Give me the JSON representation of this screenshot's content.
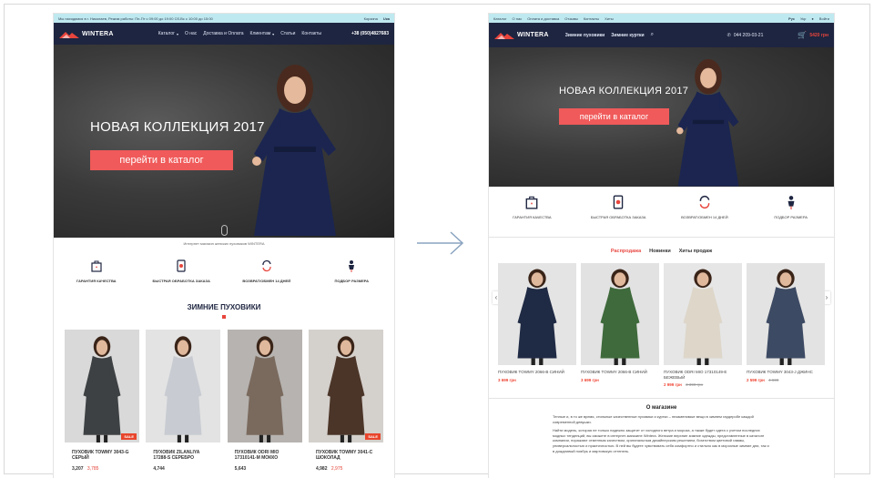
{
  "left": {
    "topbar": {
      "info": "Мы находимся в г. Николаев, Режим работы: Пн-Пт с 09:00 до 19:00 Сб-Вс с 10:00 до 15:00",
      "right1": "Корзина",
      "right2": "Uка"
    },
    "nav": {
      "brand": "WINTERA",
      "items": [
        "Каталог",
        "О нас",
        "Доставка и Оплата",
        "Клиентам",
        "Статьи",
        "Контакты"
      ],
      "phone": "+38 (050)4827683"
    },
    "hero": {
      "title": "НОВАЯ КОЛЛЕКЦИЯ 2017",
      "cta": "перейти в каталог"
    },
    "caption": "Интернет магазин женских пуховиков WINTERA",
    "features": [
      {
        "icon": "shopping-bag-icon",
        "label": "ГАРАНТИЯ КАЧЕСТВА"
      },
      {
        "icon": "phone-order-icon",
        "label": "БЫСТРАЯ ОБРАБОТКА ЗАКАЗА"
      },
      {
        "icon": "exchange-arrows-icon",
        "label": "ВОЗВРАТ/ОБМЕН 14 ДНЕЙ"
      },
      {
        "icon": "mannequin-icon",
        "label": "ПОДБОР РАЗМЕРА"
      }
    ],
    "section_title": "ЗИМНИЕ ПУХОВИКИ",
    "products": [
      {
        "name": "ПУХОВИК TOWMY 3043-G СЕРЫЙ",
        "price": "3,207",
        "old": "3,785",
        "sale": "SALE",
        "coat": "#3d4143",
        "bg": "#d9d9d9"
      },
      {
        "name": "ПУХОВИК ZILANLIYA 17288-S СЕРЕБРО",
        "price": "4,744",
        "old": "",
        "sale": "",
        "coat": "#c8ccd2",
        "bg": "#e3e3e3"
      },
      {
        "name": "ПУХОВИК ODRI MIO 17310141-M МОККО",
        "price": "5,643",
        "old": "",
        "sale": "",
        "coat": "#7a6a5e",
        "bg": "#b6b3b0"
      },
      {
        "name": "ПУХОВИК TOWMY 3041-C ШОКОЛАД",
        "price": "4,982",
        "old": "2,975",
        "sale": "SALE",
        "coat": "#4b3528",
        "bg": "#d4d0cc"
      }
    ]
  },
  "right": {
    "topbar": {
      "items": [
        "Каталог",
        "О нас",
        "Оплата и доставка",
        "Отзывы",
        "Контакты",
        "Хиты"
      ],
      "right": [
        "Рус",
        "Укр",
        "Войти"
      ]
    },
    "nav": {
      "brand": "WINTERA",
      "items": [
        "Зимние пуховики",
        "Зимние куртки"
      ],
      "phone": "044 209-03-21",
      "cart": "5420 грн"
    },
    "hero": {
      "title": "НОВАЯ КОЛЛЕКЦИЯ 2017",
      "cta": "перейти в каталог"
    },
    "features": [
      {
        "icon": "shopping-bag-icon",
        "label": "ГАРАНТИЯ КАЧЕСТВА"
      },
      {
        "icon": "phone-order-icon",
        "label": "БЫСТРАЯ ОБРАБОТКА ЗАКАЗА"
      },
      {
        "icon": "exchange-arrows-icon",
        "label": "ВОЗВРАТ/ОБМЕН 14 ДНЕЙ"
      },
      {
        "icon": "mannequin-icon",
        "label": "ПОДБОР РАЗМЕРА"
      }
    ],
    "tabs": [
      "Распродажа",
      "Новинки",
      "Хиты продаж"
    ],
    "products": [
      {
        "name": "ПУХОВИК TOWMY 2066-B СИНИЙ",
        "price": "3 699 грн",
        "old": "",
        "coat": "#1f2a44",
        "bg": "#e4e4e4"
      },
      {
        "name": "ПУХОВИК TOWMY 2066-B СИНИЙ",
        "price": "3 699 грн",
        "old": "",
        "coat": "#3f6a3c",
        "bg": "#e2e2e2"
      },
      {
        "name": "ПУХОВИК ODRI MIO 17310149-E БЕЖЕВЫЙ",
        "price": "2 999 грн",
        "old": "3 399 грн",
        "coat": "#ddd6c9",
        "bg": "#e6e6e6"
      },
      {
        "name": "ПУХОВИК TOWMY 3043-J ДЖИНС",
        "price": "2 599 грн",
        "old": "4 699",
        "coat": "#3d4a63",
        "bg": "#e3e3e3"
      }
    ],
    "about_title": "О магазине",
    "about_text": [
      "Теплые и, в то же время, стильные качественные пуховики и куртки – незаменимые вещи в зимнем гардеробе каждой современной девушки.",
      "Найти модель, которая не только надежно защитит от холодного ветра и мороза, а также будет одета с учетом последних модных тенденций, вы сможете в интернет-магазине Wintera. Женские верхние зимние одежды, представленные в каталоге компании, поражают отменным качеством, оригинальным дизайнерским решением, богатством цветовой гаммы, универсальностью и практичностью. В ней вы будете чувствовать себя комфортно и стильно как в морозные зимние дни, так и в дождливый ноябрь и мартовскую оттепель."
    ]
  },
  "colors": {
    "accent": "#f05a5a",
    "navy": "#1e2540",
    "topbar": "#bfe9f0",
    "price": "#e43f33"
  }
}
